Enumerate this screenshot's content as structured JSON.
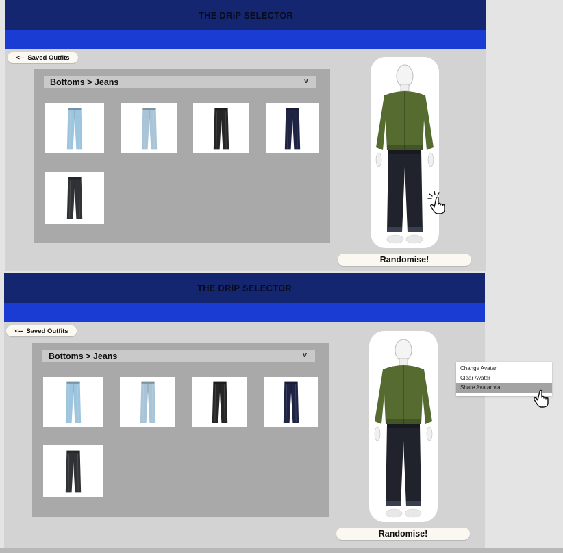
{
  "app": {
    "title": "THE DRiP SELECTOR",
    "saved_outfits_label": "Saved Outfits",
    "back_arrow": "<--",
    "category_path": "Bottoms > Jeans",
    "dropdown_chevron": "v",
    "randomise_label": "Randomise!"
  },
  "colors": {
    "title_bar": "#142670",
    "sub_bar": "#1a3cd3",
    "panel": "#a9a9a9",
    "background": "#d3d3d3",
    "button": "#faf8f0"
  },
  "jeans_thumbnails": [
    {
      "icon": "light-distressed-jeans-icon",
      "color": "#9ec5de"
    },
    {
      "icon": "light-ripped-jeans-icon",
      "color": "#a8c4d6"
    },
    {
      "icon": "black-jeans-icon",
      "color": "#262626"
    },
    {
      "icon": "navy-jeans-icon",
      "color": "#1f2444"
    },
    {
      "icon": "charcoal-jeans-icon",
      "color": "#303236"
    }
  ],
  "avatar": {
    "jacket_color": "#556b2f",
    "jeans_color": "#20232c",
    "icon": "mannequin-avatar-icon"
  },
  "context_menu": {
    "items": [
      "Change Avatar",
      "Clear Avatar",
      "Share Avatar via..."
    ],
    "highlighted_index": 2
  }
}
